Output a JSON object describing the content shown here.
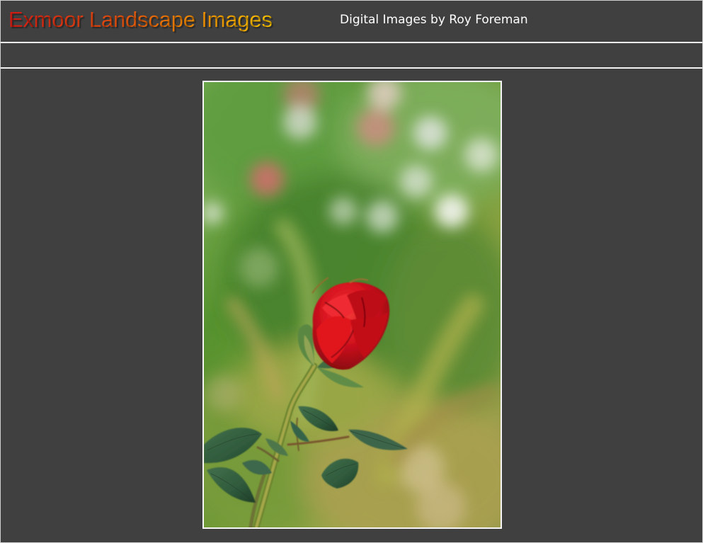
{
  "header": {
    "site_title": "Exmoor Landscape Images",
    "subtitle": "Digital Images by Roy Foreman"
  },
  "nav": {
    "items": []
  },
  "photo": {
    "subject": "rose-bud-photo",
    "colors": {
      "background": "#404040",
      "border": "#ffffff",
      "rose_red": "#d90f18",
      "foliage_green": "#5d8b35"
    }
  }
}
